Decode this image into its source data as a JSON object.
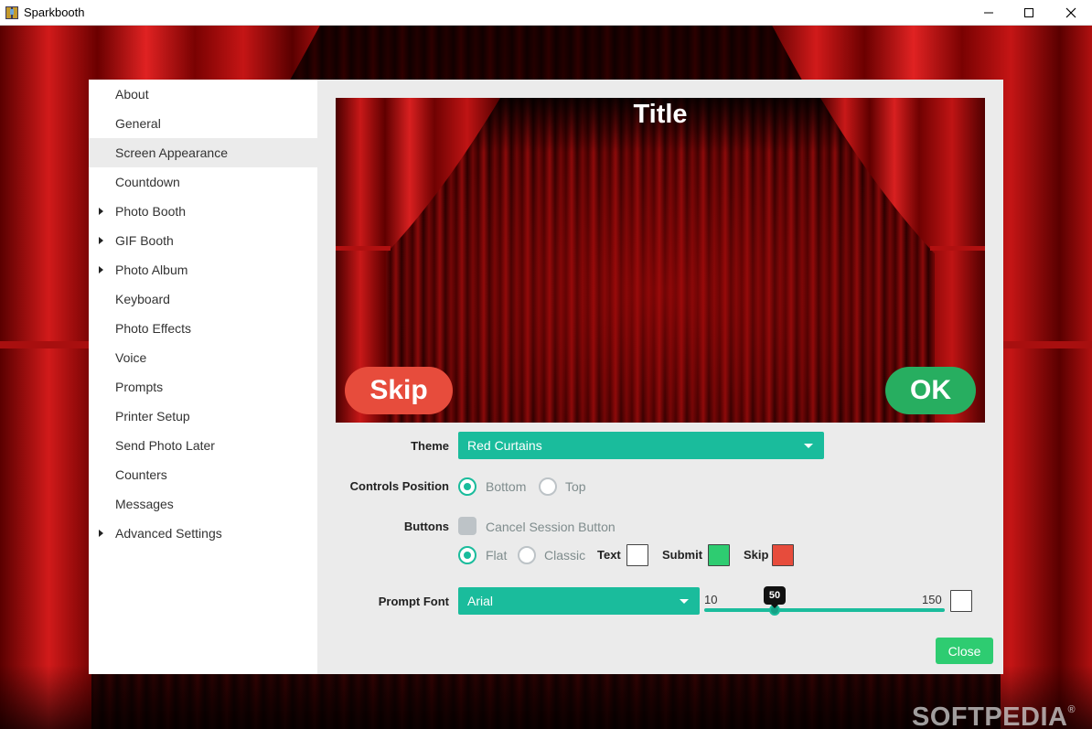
{
  "window": {
    "title": "Sparkbooth",
    "icon": "sparkbooth-app-icon",
    "controls": [
      "minimize-icon",
      "maximize-icon",
      "close-icon"
    ]
  },
  "watermark": {
    "text": "SOFTPEDIA",
    "mark": "®"
  },
  "sidebar": {
    "items": [
      {
        "label": "About",
        "expandable": false,
        "active": false
      },
      {
        "label": "General",
        "expandable": false,
        "active": false
      },
      {
        "label": "Screen Appearance",
        "expandable": false,
        "active": true
      },
      {
        "label": "Countdown",
        "expandable": false,
        "active": false
      },
      {
        "label": "Photo Booth",
        "expandable": true,
        "active": false
      },
      {
        "label": "GIF Booth",
        "expandable": true,
        "active": false
      },
      {
        "label": "Photo Album",
        "expandable": true,
        "active": false
      },
      {
        "label": "Keyboard",
        "expandable": false,
        "active": false
      },
      {
        "label": "Photo Effects",
        "expandable": false,
        "active": false
      },
      {
        "label": "Voice",
        "expandable": false,
        "active": false
      },
      {
        "label": "Prompts",
        "expandable": false,
        "active": false
      },
      {
        "label": "Printer Setup",
        "expandable": false,
        "active": false
      },
      {
        "label": "Send Photo Later",
        "expandable": false,
        "active": false
      },
      {
        "label": "Counters",
        "expandable": false,
        "active": false
      },
      {
        "label": "Messages",
        "expandable": false,
        "active": false
      },
      {
        "label": "Advanced Settings",
        "expandable": true,
        "active": false
      }
    ]
  },
  "preview": {
    "title": "Title",
    "skip_label": "Skip",
    "ok_label": "OK"
  },
  "form": {
    "theme": {
      "label": "Theme",
      "value": "Red Curtains"
    },
    "controls_position": {
      "label": "Controls Position",
      "options": [
        {
          "label": "Bottom",
          "checked": true
        },
        {
          "label": "Top",
          "checked": false
        }
      ]
    },
    "buttons": {
      "label": "Buttons",
      "cancel_session_label": "Cancel Session Button",
      "cancel_session_checked": false,
      "style_options": [
        {
          "label": "Flat",
          "checked": true
        },
        {
          "label": "Classic",
          "checked": false
        }
      ],
      "text_label": "Text",
      "text_color": "#ffffff",
      "submit_label": "Submit",
      "submit_color": "#2ecc71",
      "skip_label": "Skip",
      "skip_color": "#e74c3c"
    },
    "prompt_font": {
      "label": "Prompt Font",
      "value": "Arial",
      "size_min": "10",
      "size_max": "150",
      "size_value": "50",
      "color": "#ffffff"
    }
  },
  "footer": {
    "close_label": "Close"
  },
  "colors": {
    "accent": "#1abc9c",
    "skip": "#e74c3c",
    "ok": "#27ae60",
    "close": "#2ecc71"
  }
}
